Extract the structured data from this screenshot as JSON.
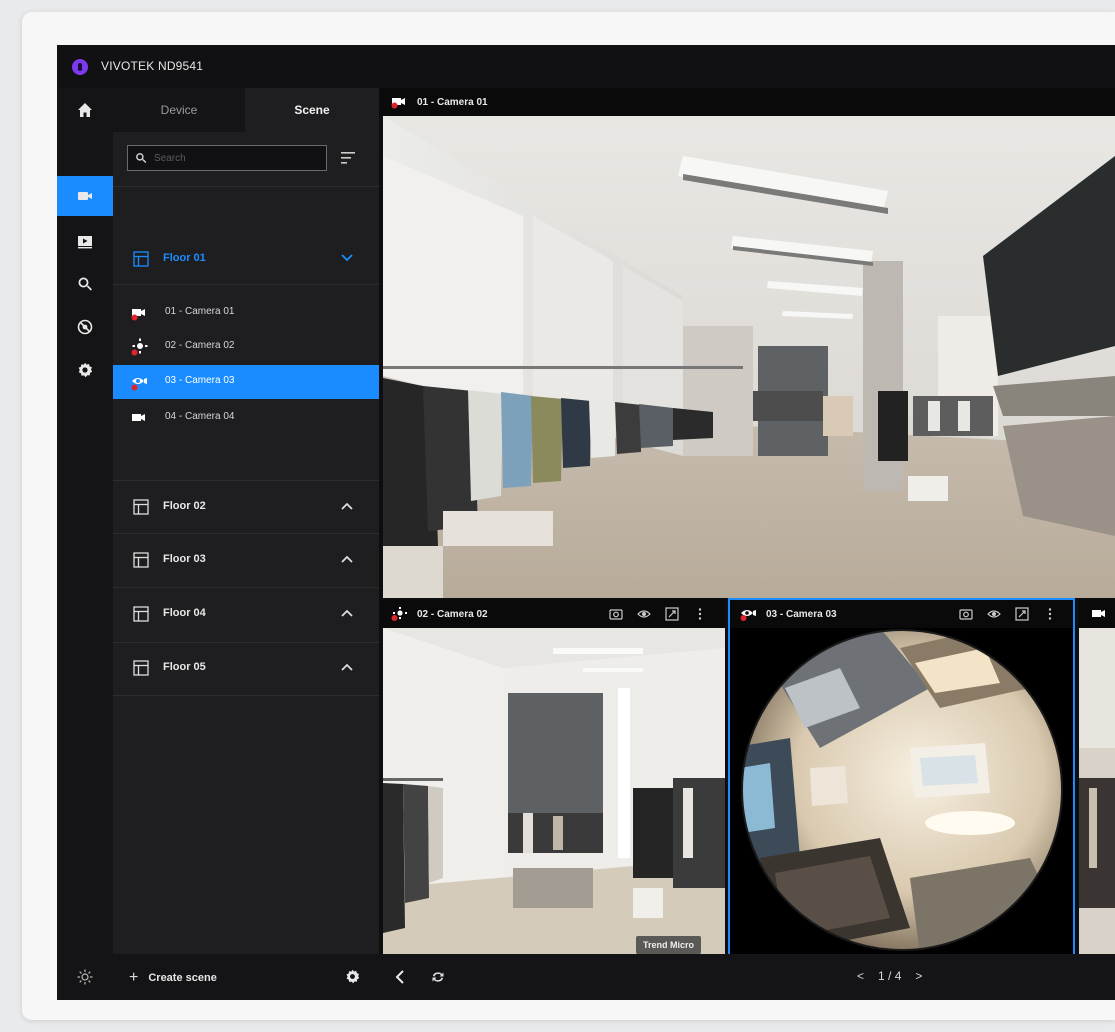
{
  "app": {
    "title": "VIVOTEK ND9541"
  },
  "colors": {
    "accent": "#1a8cff",
    "brand": "#7c3aed",
    "alert": "#e0242b"
  },
  "rail": {
    "items": [
      {
        "icon": "home-icon"
      },
      {
        "icon": "camera-icon",
        "active": true
      },
      {
        "icon": "playback-icon"
      },
      {
        "icon": "search-icon"
      },
      {
        "icon": "alarm-icon"
      },
      {
        "icon": "settings-icon"
      }
    ],
    "footer_icon": "brightness-icon"
  },
  "panel": {
    "tabs": [
      "Device",
      "Scene"
    ],
    "active_tab": "Scene",
    "search": {
      "placeholder": "Search",
      "value": ""
    },
    "floors": [
      {
        "label": "Floor 01",
        "expanded": true,
        "cameras": [
          {
            "label": "01 - Camera 01",
            "icon": "bullet-camera-icon",
            "alert": true
          },
          {
            "label": "02 - Camera 02",
            "icon": "ptz-camera-icon",
            "alert": true
          },
          {
            "label": "03 - Camera 03",
            "icon": "fisheye-camera-icon",
            "alert": true,
            "selected": true
          },
          {
            "label": "04 - Camera 04",
            "icon": "bullet-camera-icon",
            "alert": false
          }
        ]
      },
      {
        "label": "Floor 02",
        "expanded": false
      },
      {
        "label": "Floor 03",
        "expanded": false
      },
      {
        "label": "Floor 04",
        "expanded": false
      },
      {
        "label": "Floor 05",
        "expanded": false
      }
    ],
    "footer": {
      "create_label": "Create scene"
    }
  },
  "video": {
    "tiles": [
      {
        "label": "01 - Camera 01"
      },
      {
        "label": "02 - Camera 02"
      },
      {
        "label": "03 - Camera 03",
        "selected": true
      }
    ],
    "watermark": "Trend Micro",
    "pager": {
      "prev": "<",
      "current": "1",
      "sep": "/",
      "total": "4",
      "next": ">"
    }
  }
}
